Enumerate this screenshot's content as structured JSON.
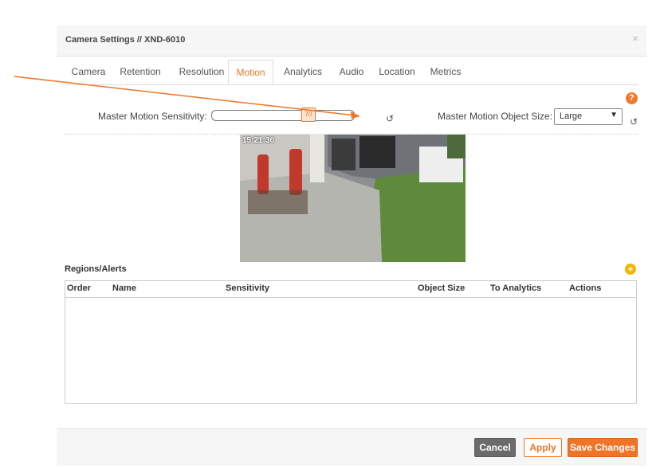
{
  "dialog": {
    "title": "Camera Settings // XND-6010",
    "close_label": "×"
  },
  "tabs": [
    {
      "label": "Camera"
    },
    {
      "label": "Retention"
    },
    {
      "label": "Resolution"
    },
    {
      "label": "Motion",
      "active": true
    },
    {
      "label": "Analytics"
    },
    {
      "label": "Audio"
    },
    {
      "label": "Location"
    },
    {
      "label": "Metrics"
    }
  ],
  "motion": {
    "help_label": "?",
    "sensitivity_label": "Master Motion Sensitivity:",
    "sensitivity_value": "70",
    "sensitivity_fraction": 0.7,
    "object_size_label": "Master Motion Object Size:",
    "object_size_value": "Large",
    "reset_icon": "↺",
    "camera_timestamp": "15:21:36"
  },
  "regions": {
    "title": "Regions/Alerts",
    "add_label": "+",
    "columns": [
      "Order",
      "Name",
      "Sensitivity",
      "Object Size",
      "To Analytics",
      "Actions"
    ],
    "rows": []
  },
  "footer": {
    "cancel_label": "Cancel",
    "apply_label": "Apply",
    "save_label": "Save Changes"
  },
  "colors": {
    "accent": "#f07427",
    "cancel": "#6b6b6b",
    "add": "#f5b400"
  }
}
